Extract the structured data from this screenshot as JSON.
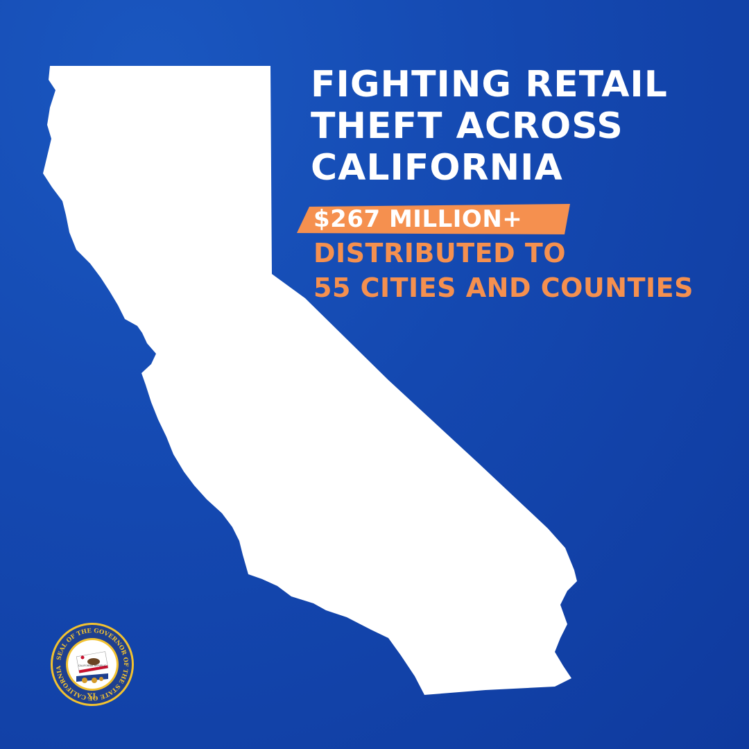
{
  "headline": {
    "line1": "FIGHTING RETAIL",
    "line2": "THEFT ACROSS",
    "line3": "CALIFORNIA"
  },
  "highlight": {
    "amount": "$267 MILLION+"
  },
  "subhead": {
    "line1": "DISTRIBUTED TO",
    "line2": "55 CITIES AND COUNTIES"
  },
  "seal": {
    "ring_text": "SEAL OF THE GOVERNOR OF THE STATE OF CALIFORNIA",
    "roman_numeral": "XL",
    "flag_text": "CALIFORNIA REPUBLIC"
  },
  "colors": {
    "background": "#1448b0",
    "headline": "#ffffff",
    "accent": "#f5904f",
    "highlight_bar": "#f5904f",
    "map": "#ffffff"
  },
  "icons": [
    "california-state-map",
    "governor-seal-icon"
  ]
}
